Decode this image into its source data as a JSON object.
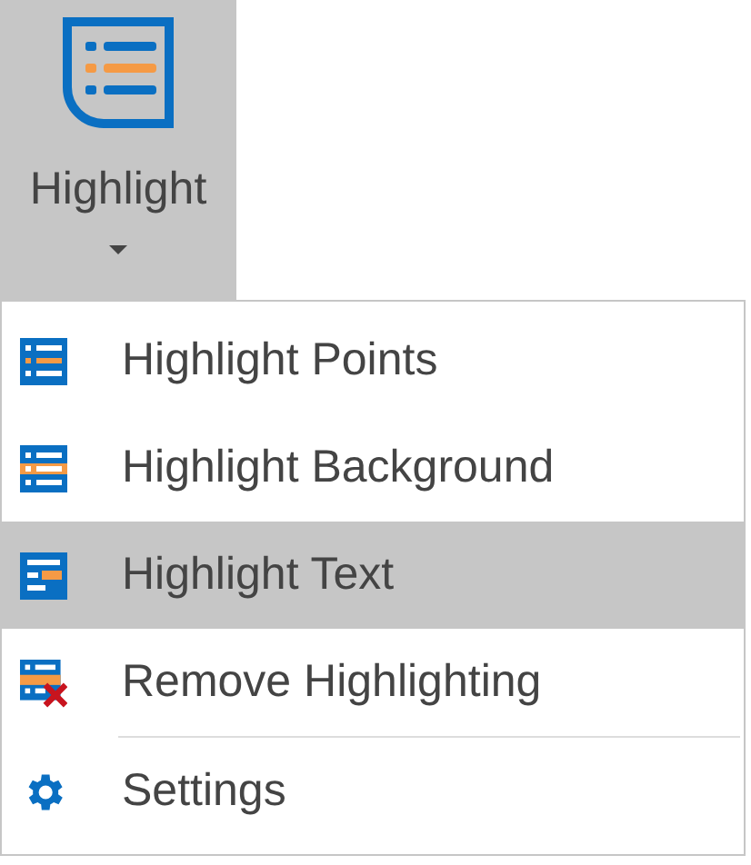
{
  "ribbon_button": {
    "label": "Highlight",
    "selected": true,
    "expanded": true
  },
  "menu": {
    "items": [
      {
        "kind": "points",
        "label": "Highlight Points",
        "selected": false
      },
      {
        "kind": "background",
        "label": "Highlight Background",
        "selected": false
      },
      {
        "kind": "text",
        "label": "Highlight Text",
        "selected": true
      },
      {
        "kind": "remove",
        "label": "Remove Highlighting",
        "selected": false
      },
      {
        "kind": "settings",
        "label": "Settings",
        "selected": false
      }
    ]
  }
}
